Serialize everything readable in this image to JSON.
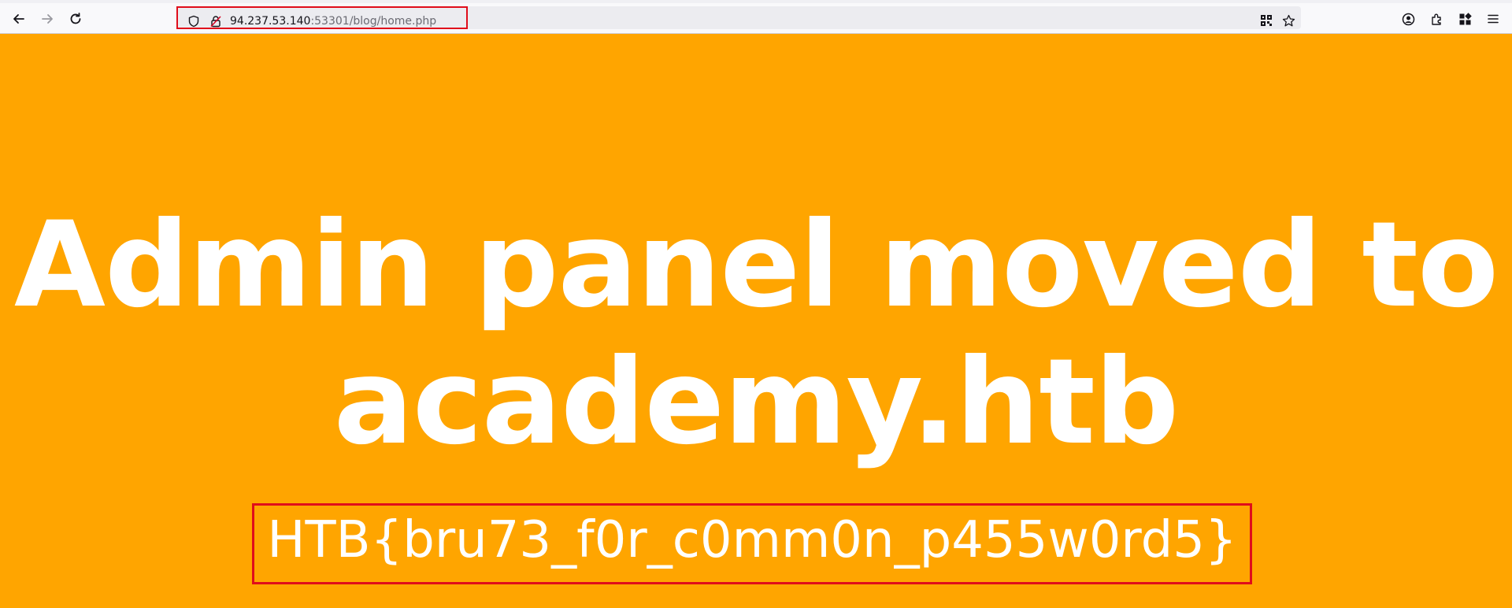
{
  "browser": {
    "back_icon": "arrow-left-icon",
    "forward_icon": "arrow-right-icon",
    "reload_icon": "reload-icon",
    "url": {
      "host": "94.237.53.140",
      "path": ":53301/blog/home.php"
    },
    "url_icons": {
      "left": [
        "shield-icon",
        "lock-broken-icon"
      ],
      "right": [
        "qr-code-icon",
        "bookmark-star-icon"
      ]
    },
    "toolbar_right_icons": [
      "account-icon",
      "extensions-icon",
      "apps-icon",
      "menu-icon"
    ]
  },
  "page": {
    "background_color": "#ffa500",
    "headline": "Admin panel moved to academy.htb",
    "flag": "HTB{bru73_f0r_c0mm0n_p455w0rd5}",
    "highlight_color": "#e00d1b"
  }
}
